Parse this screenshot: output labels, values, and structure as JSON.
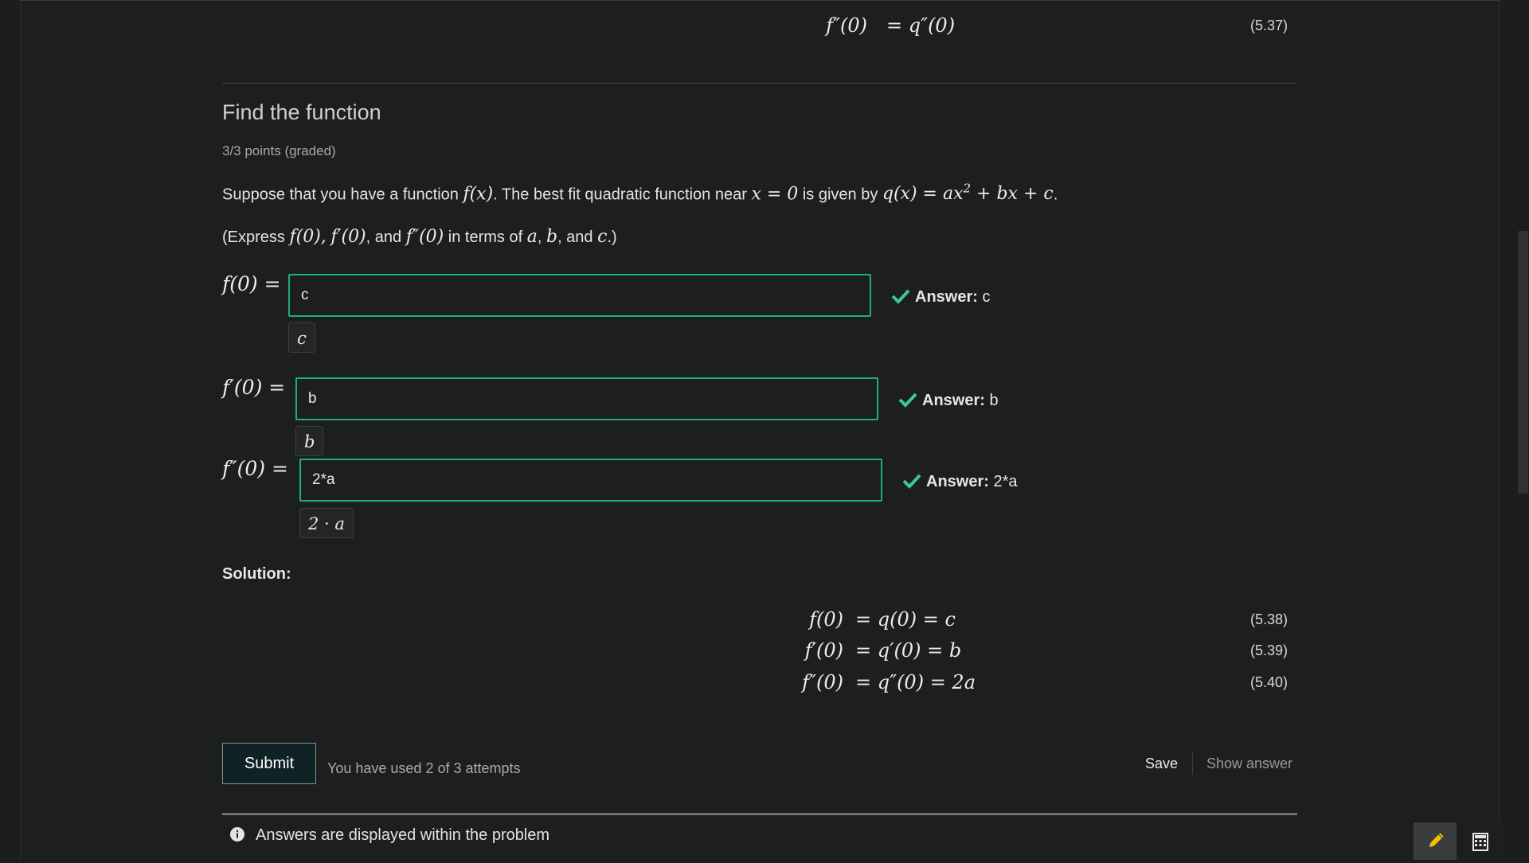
{
  "top_equation": {
    "lhs": "f″(0)",
    "rhs": "= q″(0)",
    "number": "(5.37)"
  },
  "problem": {
    "title": "Find the function",
    "points": "3/3 points (graded)",
    "intro": {
      "t1": "Suppose that you have a function ",
      "m1": "f(x)",
      "t2": ". The best fit quadratic function near ",
      "m2": "x = 0",
      "t3": " is given by ",
      "m3a": "q(x) = ax",
      "m3b": "2",
      "m3c": " + bx + c",
      "t4": "."
    },
    "instruction": {
      "t1": "(Express ",
      "m1": "f(0),",
      "m2": "f′(0)",
      "t2": ", and ",
      "m3": "f″(0)",
      "t3": " in terms of ",
      "m4": "a",
      "t4": ", ",
      "m5": "b",
      "t5": ", and ",
      "m6": "c",
      "t6": ".)"
    }
  },
  "inputs": [
    {
      "label": "f(0) =",
      "value": "c",
      "preview": "c",
      "answer_label": "Answer:",
      "answer_value": "c"
    },
    {
      "label": "f′(0) =",
      "value": "b",
      "preview": "b",
      "answer_label": "Answer:",
      "answer_value": "b"
    },
    {
      "label": "f″(0) =",
      "value": "2*a",
      "preview": "2 · a",
      "answer_label": "Answer:",
      "answer_value": "2*a"
    }
  ],
  "solution": {
    "label": "Solution:",
    "equations": [
      {
        "lhs": "f(0)",
        "rhs": "= q(0) = c",
        "number": "(5.38)"
      },
      {
        "lhs": "f′(0)",
        "rhs": "= q′(0) = b",
        "number": "(5.39)"
      },
      {
        "lhs": "f″(0)",
        "rhs": "= q″(0) = 2a",
        "number": "(5.40)"
      }
    ]
  },
  "actions": {
    "submit": "Submit",
    "attempts": "You have used 2 of 3 attempts",
    "save": "Save",
    "show_answer": "Show answer"
  },
  "notice": "Answers are displayed within the problem",
  "colors": {
    "correct": "#1fae7e",
    "check": "#3ec79a",
    "background": "#1c1e1f"
  },
  "icons": {
    "check": "check-icon",
    "info": "info-icon",
    "pencil": "pencil-icon",
    "calculator": "calculator-icon"
  }
}
